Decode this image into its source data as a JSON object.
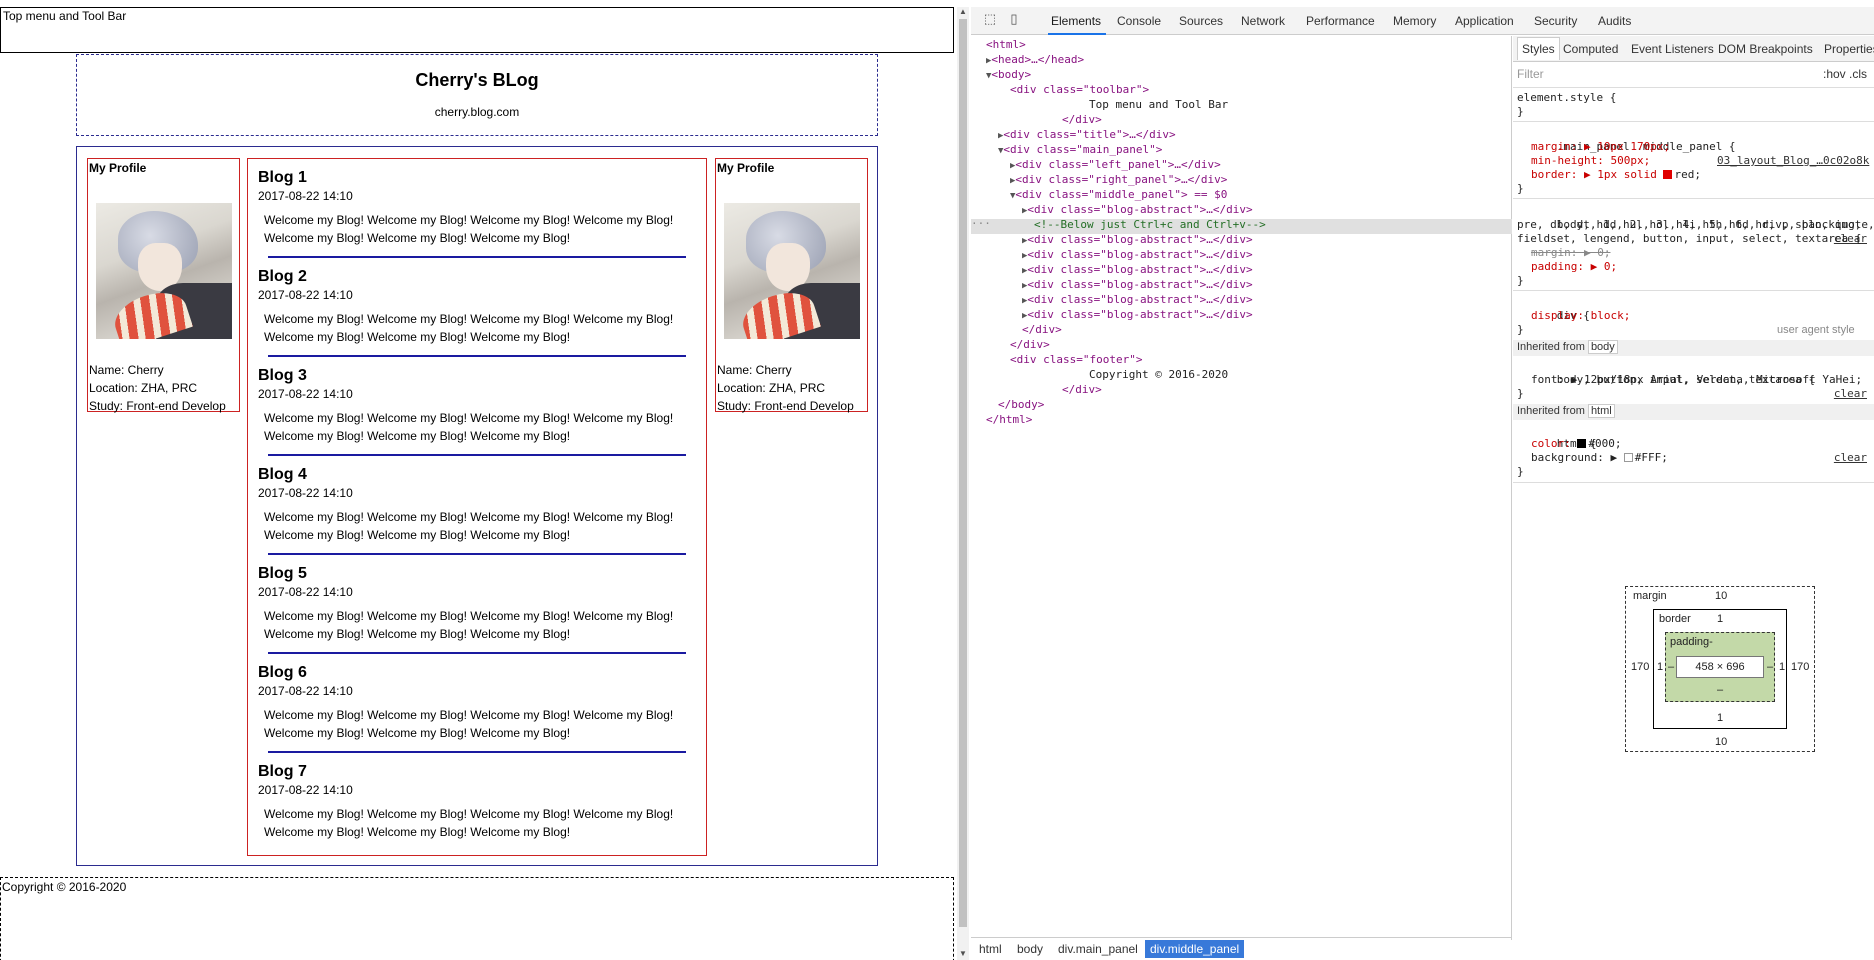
{
  "blog": {
    "toolbar_text": "Top menu and Tool Bar",
    "title": "Cherry's BLog",
    "subtitle": "cherry.blog.com",
    "left_profile": {
      "heading": "My Profile",
      "name": "Name: Cherry",
      "location": "Location: ZHA, PRC",
      "study": "Study: Front-end Develop"
    },
    "right_profile": {
      "heading": "My Profile",
      "name": "Name: Cherry",
      "location": "Location: ZHA, PRC",
      "study": "Study: Front-end Develop"
    },
    "posts": [
      {
        "title": "Blog 1",
        "date": "2017-08-22 14:10",
        "text": "Welcome my Blog! Welcome my Blog! Welcome my Blog! Welcome my Blog! Welcome my Blog! Welcome my Blog! Welcome my Blog!"
      },
      {
        "title": "Blog 2",
        "date": "2017-08-22 14:10",
        "text": "Welcome my Blog! Welcome my Blog! Welcome my Blog! Welcome my Blog! Welcome my Blog! Welcome my Blog! Welcome my Blog!"
      },
      {
        "title": "Blog 3",
        "date": "2017-08-22 14:10",
        "text": "Welcome my Blog! Welcome my Blog! Welcome my Blog! Welcome my Blog! Welcome my Blog! Welcome my Blog! Welcome my Blog!"
      },
      {
        "title": "Blog 4",
        "date": "2017-08-22 14:10",
        "text": "Welcome my Blog! Welcome my Blog! Welcome my Blog! Welcome my Blog! Welcome my Blog! Welcome my Blog! Welcome my Blog!"
      },
      {
        "title": "Blog 5",
        "date": "2017-08-22 14:10",
        "text": "Welcome my Blog! Welcome my Blog! Welcome my Blog! Welcome my Blog! Welcome my Blog! Welcome my Blog! Welcome my Blog!"
      },
      {
        "title": "Blog 6",
        "date": "2017-08-22 14:10",
        "text": "Welcome my Blog! Welcome my Blog! Welcome my Blog! Welcome my Blog! Welcome my Blog! Welcome my Blog! Welcome my Blog!"
      },
      {
        "title": "Blog 7",
        "date": "2017-08-22 14:10",
        "text": "Welcome my Blog! Welcome my Blog! Welcome my Blog! Welcome my Blog! Welcome my Blog! Welcome my Blog! Welcome my Blog!"
      }
    ],
    "footer_text": "Copyright © 2016-2020"
  },
  "devtools": {
    "tabs": [
      "Elements",
      "Console",
      "Sources",
      "Network",
      "Performance",
      "Memory",
      "Application",
      "Security",
      "Audits"
    ],
    "active_tab": "Elements",
    "icons": [
      "inspect-icon",
      "device-toggle-icon"
    ],
    "dom_lines": [
      "<html>",
      "<head>…</head>",
      "<body>",
      "<div class=\"toolbar\">",
      "Top menu and Tool Bar",
      "</div>",
      "<div class=\"title\">…</div>",
      "<div class=\"main_panel\">",
      "<div class=\"left_panel\">…</div>",
      "<div class=\"right_panel\">…</div>",
      "<div class=\"middle_panel\"> == $0",
      "<div class=\"blog-abstract\">…</div>",
      "<!--Below just Ctrl+c and Ctrl+v-->",
      "<div class=\"blog-abstract\">…</div>",
      "<div class=\"blog-abstract\">…</div>",
      "<div class=\"blog-abstract\">…</div>",
      "<div class=\"blog-abstract\">…</div>",
      "<div class=\"blog-abstract\">…</div>",
      "<div class=\"blog-abstract\">…</div>",
      "</div>",
      "</div>",
      "<div class=\"footer\">",
      "Copyright © 2016-2020",
      "</div>",
      "</body>",
      "</html>"
    ],
    "breadcrumbs": [
      "html",
      "body",
      "div.main_panel",
      "div.middle_panel"
    ],
    "styles_tabs": [
      "Styles",
      "Computed",
      "Event Listeners",
      "DOM Breakpoints",
      "Properties"
    ],
    "filter_placeholder": "Filter",
    "filter_toggle": ":hov .cls",
    "rules": {
      "element_style": "element.style {",
      "close": "}",
      "middle_selector": ".main_panel .middle_panel {",
      "middle_source": "03_layout_Blog_…0c02o8k",
      "margin": "margin: ▶ 10px 170px;",
      "min_height": "min-height: 500px;",
      "border": "border: ▶ 1px solid ",
      "border_color": "red",
      "reset_selector_1": "body, h1, h2, h3, h4, h5, h6, hr, p, blockquote,",
      "reset_selector_2": "pre, dl, dt, dd, ul, ol, li, th, td, div, span, img,",
      "reset_selector_3": "fieldset, lengend, button, input, select, textarea {",
      "reset_margin": "margin: ▶ 0;",
      "reset_padding": "padding: ▶ 0;",
      "clear_label": "clear",
      "div_selector": "div {",
      "div_display": "display: block;",
      "user_agent": "user agent style",
      "inherited_body": "Inherited from",
      "inherited_body_tag": "body",
      "font_selector": "body, button, input, select, textarea {",
      "font_value": "font: ▶ 12px/18px Arial, Verdana, Microsoft YaHei;",
      "inherited_html": "Inherited from",
      "inherited_html_tag": "html",
      "html_selector": "html {",
      "color_value": "color: ",
      "color_hex": "#000;",
      "background_value": "background: ▶ ",
      "background_hex": "#FFF;"
    },
    "box_model": {
      "margin_label": "margin",
      "margin_top": "10",
      "margin_bottom": "10",
      "margin_left": "170",
      "margin_right": "170",
      "border_label": "border",
      "border_top": "1",
      "border_bottom": "1",
      "border_left": "1",
      "border_right": "1",
      "padding_label": "padding-",
      "padding_bottom": "–",
      "padding_left": "–",
      "padding_right": "–",
      "content_size": "458 × 696"
    },
    "colors": {
      "accent": "#1a73e8",
      "tag": "#881280",
      "attr_name": "#994500",
      "attr_value": "#1a1aa6",
      "red_border": "#cc2222",
      "blue_border": "#2b2b8f"
    }
  }
}
